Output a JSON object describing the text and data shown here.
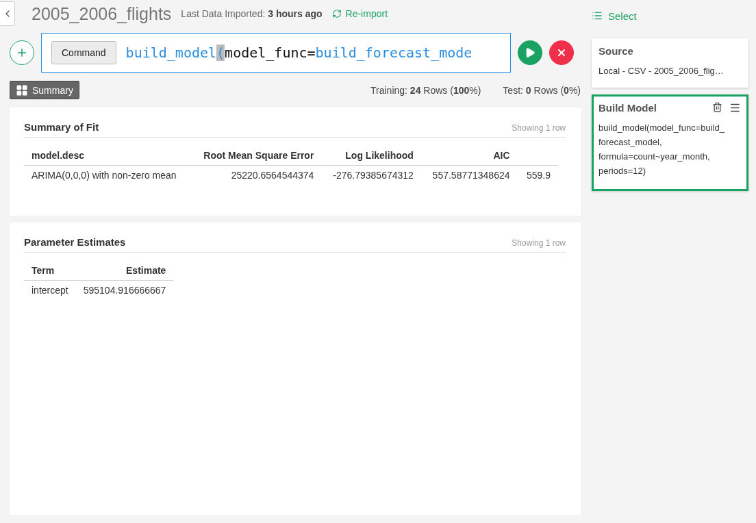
{
  "header": {
    "title": "2005_2006_flights",
    "imported": "Last Data Imported: **3 hours ago**",
    "reimport": "Re-import"
  },
  "command": {
    "mode_button": "Command",
    "segments": [
      {
        "text": "build_model",
        "kind": "name"
      },
      {
        "text": "(",
        "kind": "bracket"
      },
      {
        "text": "model_func=",
        "kind": "arg"
      },
      {
        "text": "build_forecast_mode",
        "kind": "name"
      }
    ]
  },
  "view_button": "Summary",
  "split": {
    "training": "Training: **24** Rows (**100**%)",
    "test": "Test: **0** Rows (**0**%)"
  },
  "cards": [
    {
      "title": "Summary of Fit",
      "count": "Showing 1 row",
      "columns": [
        "model.desc",
        "Root Mean Square Error",
        "Log Likelihood",
        "AIC"
      ],
      "rows": [
        [
          "ARIMA(0,0,0) with non-zero mean",
          "25220.6564544374",
          "-276.79385674312",
          "557.58771348624",
          "559.9"
        ]
      ]
    },
    {
      "title": "Parameter Estimates",
      "count": "Showing 1 row",
      "columns": [
        "Term",
        "Estimate"
      ],
      "rows": [
        [
          "intercept",
          "595104.916666667"
        ]
      ]
    }
  ],
  "sidebar": {
    "select": "Select",
    "steps": [
      {
        "title": "Source",
        "body": "Local - CSV - 2005_2006_flig…",
        "selected": false
      },
      {
        "title": "Build Model",
        "body": "build_model(model_func=build_ forecast_model, formula=count~year_month, periods=12)",
        "selected": true
      }
    ]
  }
}
